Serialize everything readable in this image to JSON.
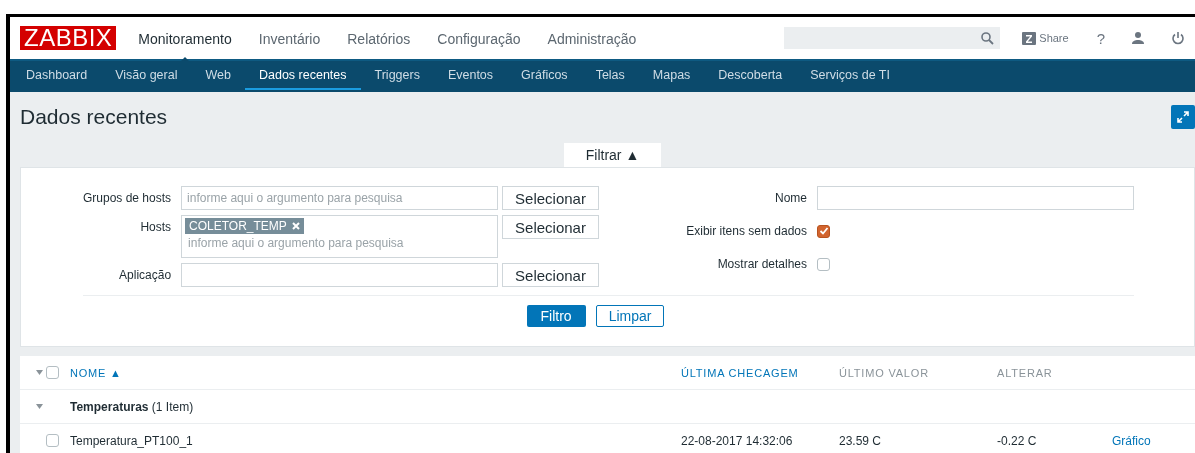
{
  "header": {
    "logo": "ZABBIX",
    "menu": [
      {
        "label": "Monitoramento",
        "selected": true
      },
      {
        "label": "Inventário",
        "selected": false
      },
      {
        "label": "Relatórios",
        "selected": false
      },
      {
        "label": "Configuração",
        "selected": false
      },
      {
        "label": "Administração",
        "selected": false
      }
    ],
    "share": "Share",
    "help": "?"
  },
  "submenu": [
    {
      "label": "Dashboard",
      "selected": false
    },
    {
      "label": "Visão geral",
      "selected": false
    },
    {
      "label": "Web",
      "selected": false
    },
    {
      "label": "Dados recentes",
      "selected": true
    },
    {
      "label": "Triggers",
      "selected": false
    },
    {
      "label": "Eventos",
      "selected": false
    },
    {
      "label": "Gráficos",
      "selected": false
    },
    {
      "label": "Telas",
      "selected": false
    },
    {
      "label": "Mapas",
      "selected": false
    },
    {
      "label": "Descoberta",
      "selected": false
    },
    {
      "label": "Serviços de TI",
      "selected": false
    }
  ],
  "page_title": "Dados recentes",
  "filter": {
    "tab": "Filtrar ▲",
    "left": [
      {
        "label": "Grupos de hosts",
        "placeholder": "informe aqui o argumento para pesquisa",
        "button": "Selecionar"
      },
      {
        "label": "Hosts",
        "tags": [
          "COLETOR_TEMP"
        ],
        "placeholder": "informe aqui o argumento para pesquisa",
        "button": "Selecionar"
      },
      {
        "label": "Aplicação",
        "button": "Selecionar"
      }
    ],
    "right": [
      {
        "kind": "text",
        "label": "Nome"
      },
      {
        "kind": "checkbox",
        "label": "Exibir itens sem dados",
        "checked": true
      },
      {
        "kind": "checkbox",
        "label": "Mostrar detalhes",
        "checked": false
      }
    ],
    "apply": "Filtro",
    "reset": "Limpar"
  },
  "table": {
    "select_all": false,
    "columns": [
      {
        "label": "NOME ▲",
        "sortable": true
      },
      {
        "label": "ÚLTIMA CHECAGEM",
        "sortable": true
      },
      {
        "label": "ÚLTIMO VALOR",
        "sortable": false
      },
      {
        "label": "ALTERAR",
        "sortable": false
      }
    ],
    "groups": [
      {
        "name": "Temperaturas",
        "count": "(1 Item)",
        "expanded": true,
        "rows": [
          {
            "name": "Temperatura_PT100_1",
            "checked": false,
            "last_check": "22-08-2017 14:32:06",
            "last_value": "23.59 C",
            "change": "-0.22 C",
            "link": "Gráfico"
          }
        ]
      }
    ]
  }
}
